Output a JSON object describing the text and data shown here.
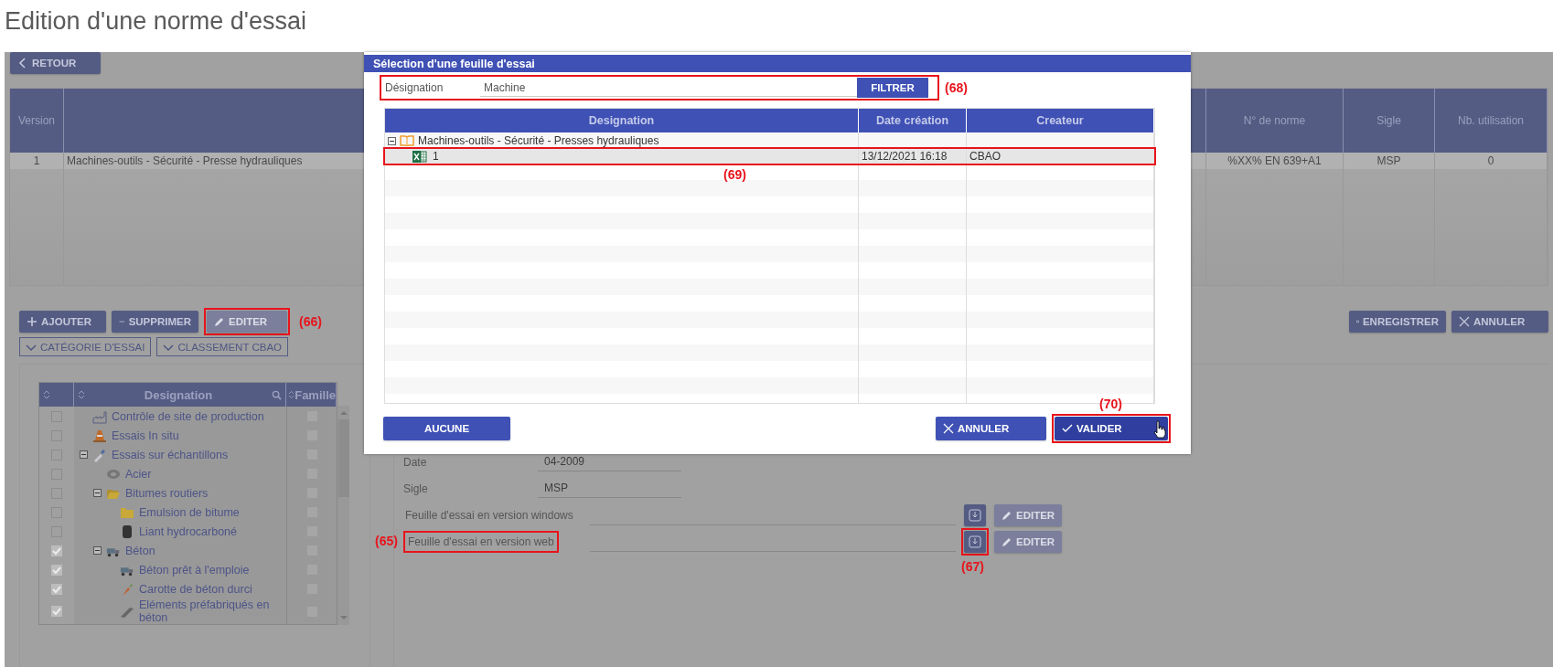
{
  "page_title": "Edition d'une norme d'essai",
  "back_button": {
    "label": "RETOUR"
  },
  "norms_table": {
    "columns": [
      "Version",
      "",
      "N° de norme",
      "Sigle",
      "Nb. utilisation"
    ],
    "rows": [
      {
        "selected": true,
        "cells": [
          "1",
          "Machines-outils - Sécurité - Presse hydrauliques",
          "%XX% EN 639+A1",
          "MSP",
          "0"
        ]
      }
    ]
  },
  "actions": [
    {
      "kind": "add",
      "label": "AJOUTER",
      "disabled": false
    },
    {
      "kind": "remove",
      "label": "SUPPRIMER",
      "disabled": false
    },
    {
      "kind": "edit",
      "label": "EDITER",
      "disabled": true,
      "highlighted": true,
      "callout": "(66)"
    }
  ],
  "save_actions": [
    {
      "kind": "save",
      "label": "ENREGISTRER"
    },
    {
      "kind": "cancel",
      "label": "ANNULER"
    }
  ],
  "filters": [
    "CATÉGORIE D'ESSAI",
    "CLASSEMENT CBAO"
  ],
  "tree": {
    "designation_header": "Designation",
    "famille_header": "Famille",
    "items": [
      {
        "kind": "factory",
        "label": "Contrôle de site de production",
        "checked": false,
        "famille": false
      },
      {
        "kind": "cone",
        "label": "Essais In situ",
        "checked": false,
        "famille": false
      },
      {
        "kind": "pipette",
        "label": "Essais sur échantillons",
        "checked": false,
        "famille": false,
        "expanded": true,
        "children": [
          {
            "kind": "coil",
            "label": "Acier",
            "checked": false,
            "famille": false
          },
          {
            "kind": "folder-open",
            "label": "Bitumes routiers",
            "checked": false,
            "famille": false,
            "expanded": true,
            "children": [
              {
                "kind": "folder",
                "label": "Emulsion de bitume",
                "checked": false,
                "famille": false
              },
              {
                "kind": "barrel",
                "label": "Liant hydrocarboné",
                "checked": false,
                "famille": false
              }
            ]
          },
          {
            "kind": "truck",
            "label": "Béton",
            "checked": true,
            "famille": false,
            "expanded": true,
            "children": [
              {
                "kind": "truck",
                "label": "Béton prêt à l'emploie",
                "checked": true,
                "famille": false
              },
              {
                "kind": "carrot",
                "label": "Carotte de béton durci",
                "checked": true,
                "famille": false
              },
              {
                "kind": "slab",
                "label": "Eléments préfabriqués en béton",
                "checked": true,
                "famille": false
              }
            ]
          }
        ]
      }
    ]
  },
  "form": {
    "fields": [
      {
        "label": "Date",
        "value": "04-2009"
      },
      {
        "label": "Sigle",
        "value": "MSP"
      }
    ],
    "sheets": [
      {
        "label": "Feuille d'essai en version windows",
        "highlighted": false,
        "download_highlighted": false,
        "edit_label": "EDITER"
      },
      {
        "label": "Feuille d'essai en version web",
        "highlighted": true,
        "callout": "(65)",
        "download_highlighted": true,
        "download_callout": "(67)",
        "edit_label": "EDITER"
      }
    ]
  },
  "dialog": {
    "title": "Sélection d'une feuille d'essai",
    "filter": {
      "label": "Désignation",
      "value": "Machine",
      "button": "FILTRER",
      "highlighted": true,
      "callout": "(68)"
    },
    "columns": [
      "Designation",
      "Date création",
      "Createur"
    ],
    "rows": [
      {
        "kind": "group",
        "label": "Machines-outils - Sécurité - Presses hydrauliques",
        "expanded": true,
        "children": [
          {
            "kind": "sheet",
            "cells": [
              "1",
              "13/12/2021 16:18",
              "CBAO"
            ],
            "selected": true,
            "highlighted": true,
            "callout": "(69)"
          }
        ]
      }
    ],
    "none_button": {
      "label": "AUCUNE"
    },
    "cancel_button": {
      "label": "ANNULER"
    },
    "validate_button": {
      "label": "VALIDER",
      "highlighted": true,
      "callout": "(70)"
    }
  }
}
